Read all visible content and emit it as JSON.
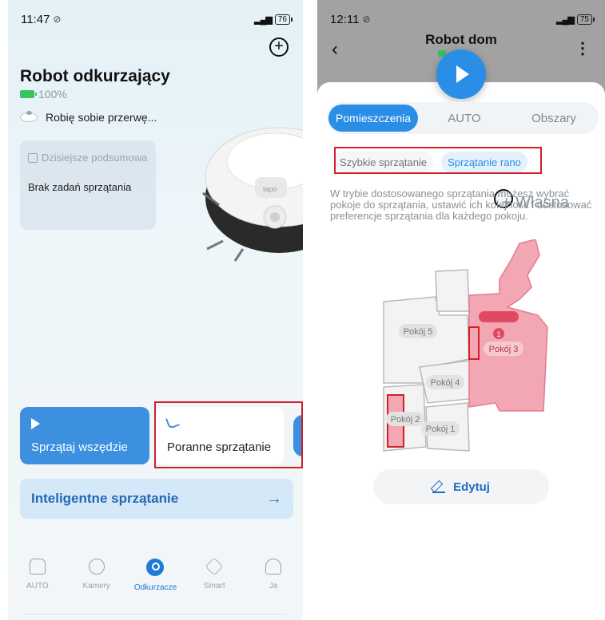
{
  "left": {
    "status": {
      "time": "11:47",
      "battery": "76"
    },
    "title": "Robot odkurzający",
    "battery_level": "100%",
    "state": "Robię sobie przerwę...",
    "summary": {
      "header": "Dzisiejsze podsumowar",
      "body": "Brak zadań sprzątania"
    },
    "robot_brand": "tapo",
    "quick_cards": [
      {
        "label": "Sprzątaj wszędzie"
      },
      {
        "label": "Poranne sprzątanie"
      }
    ],
    "smart_cleaning": {
      "label": "Inteligentne sprzątanie",
      "arrow": "→"
    },
    "nav": [
      {
        "label": "AUTO",
        "icon": "home-icon"
      },
      {
        "label": "Kamery",
        "icon": "camera-icon"
      },
      {
        "label": "Odkurzacze",
        "icon": "vacuum-icon",
        "active": true
      },
      {
        "label": "Smart",
        "icon": "cube-icon"
      },
      {
        "label": "Ja",
        "icon": "person-icon"
      }
    ],
    "colors": {
      "accent": "#3d8fe0",
      "highlight_box": "#d02028"
    }
  },
  "right": {
    "status": {
      "time": "12:11",
      "battery": "75"
    },
    "title": "Robot dom",
    "tabs": [
      {
        "label": "Pomieszczenia",
        "active": true
      },
      {
        "label": "AUTO"
      },
      {
        "label": "Obszary"
      }
    ],
    "chips": [
      {
        "label": "Szybkie sprzątanie"
      },
      {
        "label": "Sprzątanie rano",
        "selected": true
      },
      {
        "label": "+ Własna"
      }
    ],
    "description": "W trybie dostosowanego sprzątania możesz wybrać pokoje do sprzątania, ustawić ich kolejność i dostosować preferencje sprzątania dla każdego pokoju.",
    "rooms": [
      "Pokój 5",
      "Pokój 3",
      "Pokój 4",
      "Pokój 2",
      "Pokój 1"
    ],
    "room_order_badge": "1",
    "edit_button": "Edytuj",
    "colors": {
      "accent": "#2a8ee6",
      "selected_room": "#f0a0ac"
    }
  }
}
